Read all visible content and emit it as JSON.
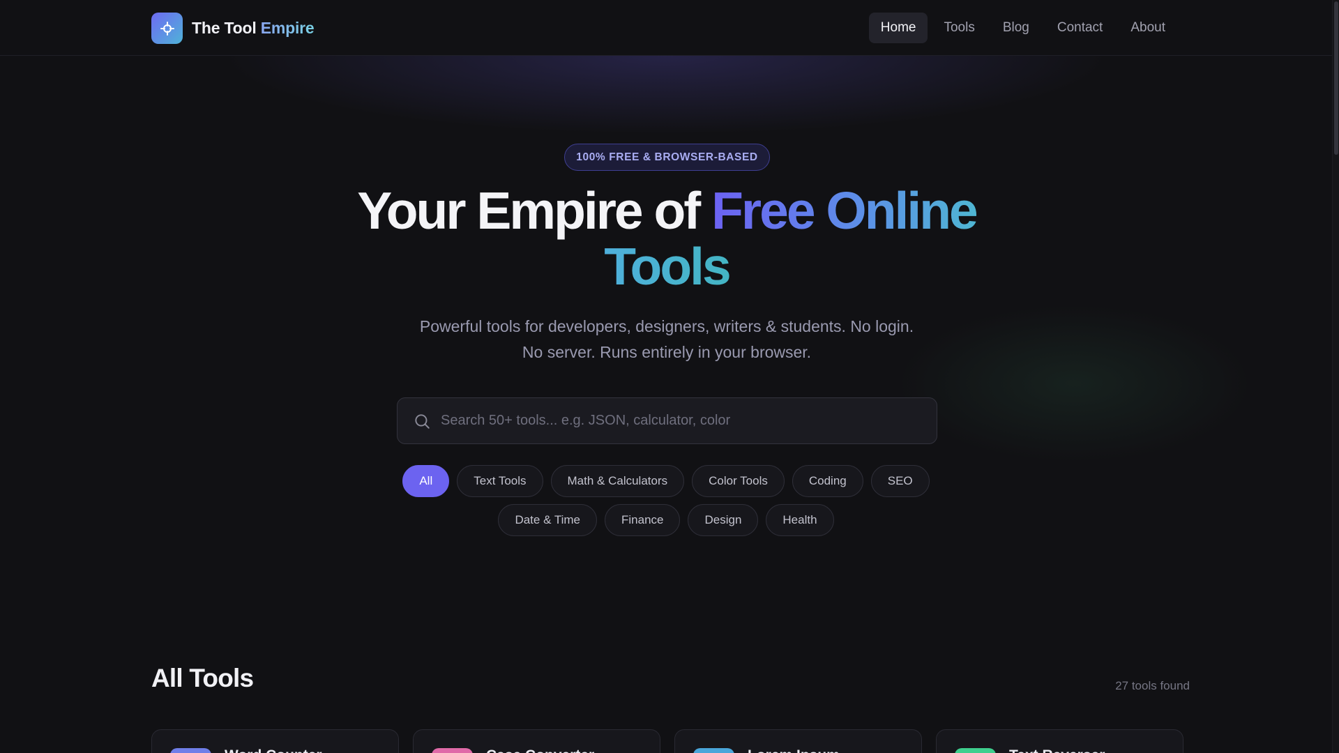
{
  "header": {
    "brand_part1": "The Tool ",
    "brand_part2": "Empire",
    "logo_icon": "crosshair-icon",
    "nav": [
      {
        "label": "Home",
        "active": true
      },
      {
        "label": "Tools",
        "active": false
      },
      {
        "label": "Blog",
        "active": false
      },
      {
        "label": "Contact",
        "active": false
      },
      {
        "label": "About",
        "active": false
      }
    ]
  },
  "hero": {
    "badge": "100% FREE & BROWSER-BASED",
    "title_plain": "Your Empire of ",
    "title_gradient_1": "Free Online",
    "title_gradient_2": "Tools",
    "subtitle": "Powerful tools for developers, designers, writers & students. No login. No server. Runs entirely in your browser."
  },
  "search": {
    "placeholder": "Search 50+ tools... e.g. JSON, calculator, color",
    "value": "",
    "icon": "search-icon"
  },
  "categories": {
    "row1": [
      "All",
      "Text Tools",
      "Math & Calculators",
      "Color Tools",
      "Coding",
      "SEO"
    ],
    "row2": [
      "Date & Time",
      "Finance",
      "Design",
      "Health"
    ],
    "selected": "All"
  },
  "tools_section": {
    "title": "All Tools",
    "count_text": "27 tools found",
    "cards": [
      {
        "name": "Word Counter",
        "color": "#6f7ee8"
      },
      {
        "name": "Case Converter",
        "color": "#e06aa8"
      },
      {
        "name": "Lorem Ipsum",
        "color": "#4aa6da"
      },
      {
        "name": "Text Reverser",
        "color": "#3fcf8e"
      }
    ]
  },
  "colors": {
    "background": "#111114",
    "accent": "#6c63f0",
    "gradient_start": "#6c62f2",
    "gradient_end": "#4fb6d3"
  }
}
